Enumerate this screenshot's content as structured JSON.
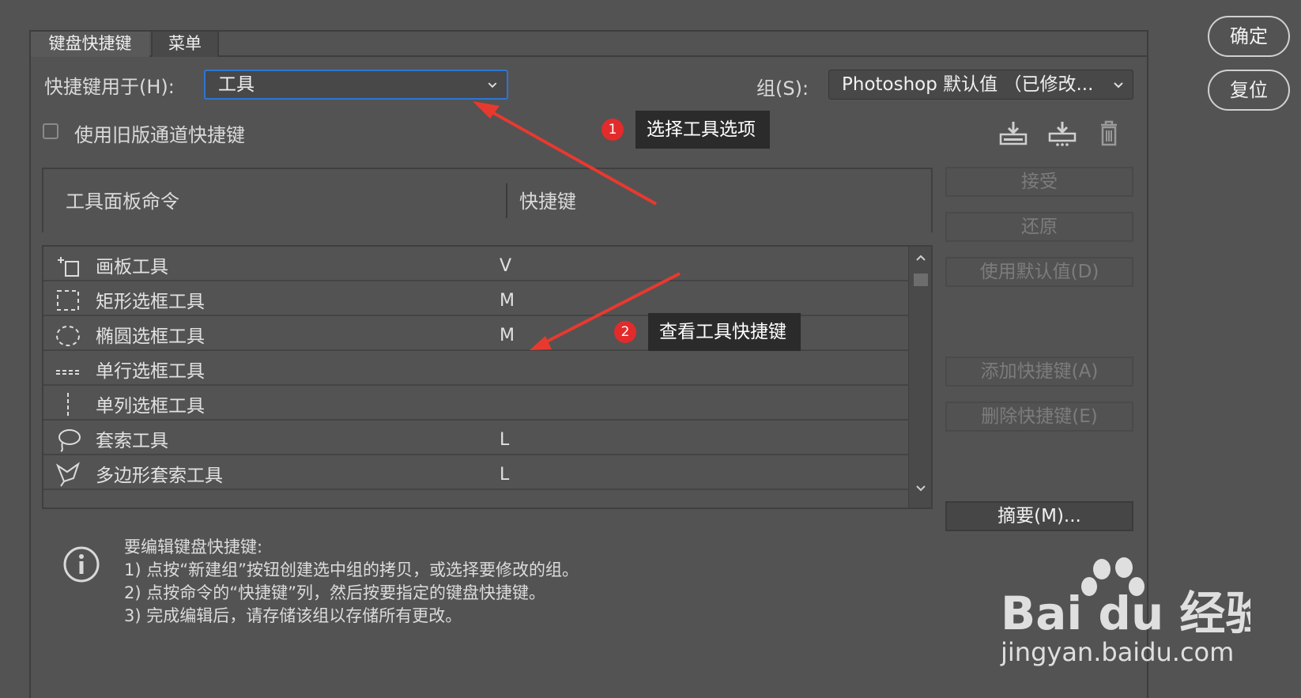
{
  "tabs": [
    {
      "label": "键盘快捷键",
      "active": true
    },
    {
      "label": "菜单",
      "active": false
    }
  ],
  "shortcuts_for": {
    "label": "快捷键用于(H):",
    "value": "工具"
  },
  "group": {
    "label": "组(S):",
    "value": "Photoshop 默认值 （已修改..."
  },
  "legacy_channel": {
    "label": "使用旧版通道快捷键",
    "checked": false
  },
  "icon_buttons": [
    "save-set-icon",
    "save-as-set-icon",
    "trash-icon"
  ],
  "table": {
    "columns": [
      "工具面板命令",
      "快捷键"
    ],
    "rows": [
      {
        "name": "画板工具",
        "key": "V",
        "icon": "artboard-tool-icon"
      },
      {
        "name": "矩形选框工具",
        "key": "M",
        "icon": "rect-marquee-icon"
      },
      {
        "name": "椭圆选框工具",
        "key": "M",
        "icon": "ellipse-marquee-icon"
      },
      {
        "name": "单行选框工具",
        "key": "",
        "icon": "single-row-marquee-icon"
      },
      {
        "name": "单列选框工具",
        "key": "",
        "icon": "single-column-marquee-icon"
      },
      {
        "name": "套索工具",
        "key": "L",
        "icon": "lasso-icon"
      },
      {
        "name": "多边形套索工具",
        "key": "L",
        "icon": "polygonal-lasso-icon"
      }
    ]
  },
  "side_buttons": {
    "accept": "接受",
    "undo": "还原",
    "use_default": "使用默认值(D)",
    "add_shortcut": "添加快捷键(A)",
    "delete_shortcut": "删除快捷键(E)",
    "summary": "摘要(M)..."
  },
  "dialog_buttons": {
    "ok": "确定",
    "reset": "复位"
  },
  "info": {
    "title": "要编辑键盘快捷键:",
    "line1": "1) 点按“新建组”按钮创建选中组的拷贝，或选择要修改的组。",
    "line2": "2) 点按命令的“快捷键”列，然后按要指定的键盘快捷键。",
    "line3": "3) 完成编辑后，请存储该组以存储所有更改。"
  },
  "annotations": [
    {
      "number": "1",
      "text": "选择工具选项"
    },
    {
      "number": "2",
      "text": "查看工具快捷键"
    }
  ],
  "watermark": {
    "brand": "Bai du 经验",
    "url": "jingyan.baidu.com"
  },
  "colors": {
    "background": "#535353",
    "accent": "#2d76d2",
    "annotation_red": "#e32b2b",
    "callout_bg": "#2b2b2b"
  }
}
